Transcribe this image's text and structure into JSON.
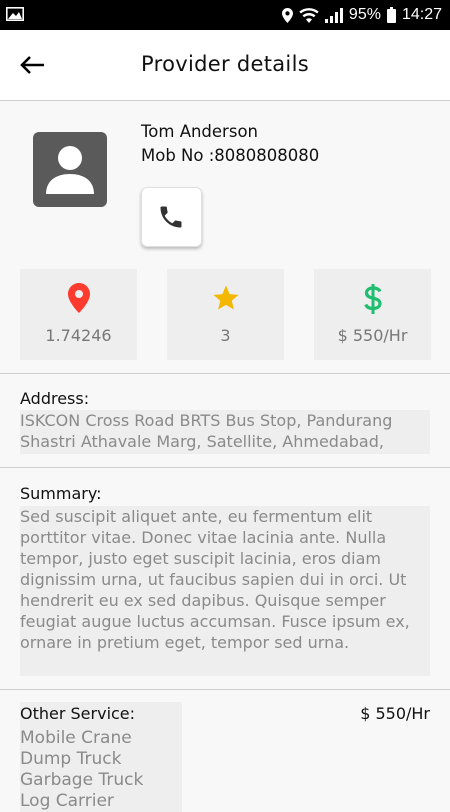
{
  "status_bar": {
    "battery": "95%",
    "time": "14:27"
  },
  "app_bar": {
    "title": "Provider details"
  },
  "provider": {
    "name": "Tom Anderson",
    "mob_label": "Mob No :",
    "mob_value": "8080808080"
  },
  "stats": {
    "distance": "1.74246",
    "rating": "3",
    "rate": "$ 550/Hr"
  },
  "address": {
    "label": "Address:",
    "text": "ISKCON Cross Road BRTS Bus Stop, Pandurang Shastri Athavale Marg, Satellite, Ahmedabad,"
  },
  "summary": {
    "label": "Summary:",
    "text": "Sed suscipit aliquet ante, eu fermentum elit porttitor vitae. Donec vitae lacinia ante. Nulla tempor, justo eget suscipit lacinia, eros diam dignissim urna, ut faucibus sapien dui in orci. Ut hendrerit eu ex sed dapibus. Quisque semper feugiat augue luctus accumsan. Fusce ipsum ex, ornare in pretium eget, tempor sed urna."
  },
  "other_service": {
    "label": "Other Service:",
    "price": "$ 550/Hr",
    "items": [
      "Mobile Crane",
      "Dump Truck",
      "Garbage Truck",
      "Log Carrier"
    ]
  },
  "colors": {
    "location_icon": "#ff3b30",
    "star_icon": "#f5b800",
    "dollar_icon": "#1fbf6f"
  }
}
